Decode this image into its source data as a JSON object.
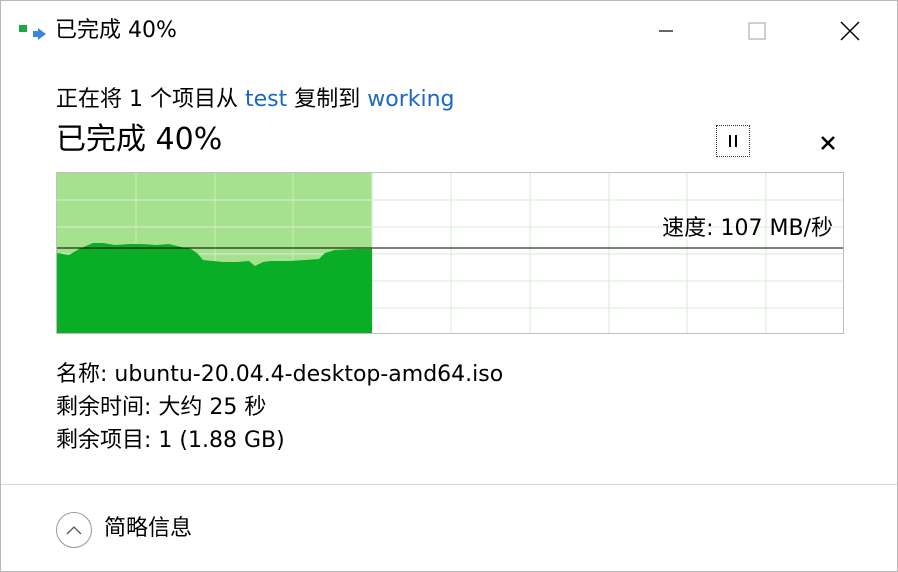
{
  "window": {
    "title": "已完成 40%"
  },
  "copy_info": {
    "prefix": "正在将 1 个项目从 ",
    "source": "test",
    "middle": " 复制到 ",
    "destination": "working"
  },
  "progress": {
    "heading": "已完成 40%",
    "percent_complete": 40,
    "speed_label": "速度: 107 MB/秒"
  },
  "controls": {
    "pause_icon": "pause-icon",
    "cancel_icon": "close-icon"
  },
  "details": {
    "name": "名称: ubuntu-20.04.4-desktop-amd64.iso",
    "time_remaining": "剩余时间: 大约 25 秒",
    "items_remaining": "剩余项目: 1 (1.88 GB)"
  },
  "footer": {
    "collapse_label": "简略信息"
  },
  "colors": {
    "graph_fill": "#0aad26",
    "graph_progress_bg": "#a6e28e",
    "grid": "#d6ecd6",
    "link": "#1a68c4"
  }
}
